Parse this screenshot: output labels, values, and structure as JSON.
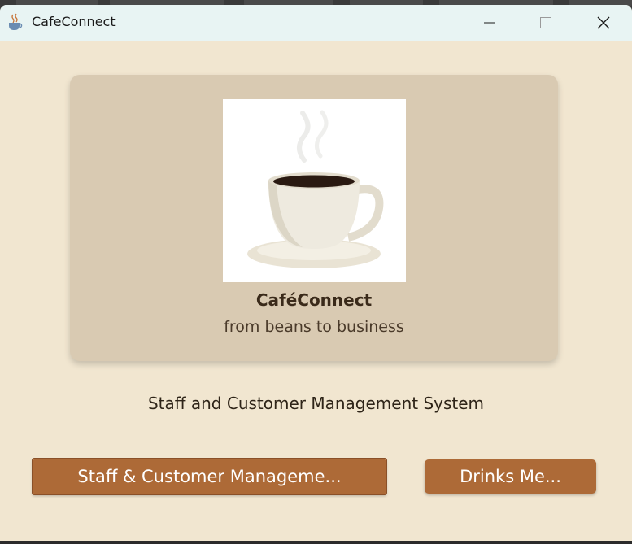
{
  "window": {
    "title": "CafeConnect",
    "app_icon": "coffee-cup-icon",
    "controls": {
      "minimize_icon": "minimize-icon",
      "maximize_icon": "maximize-icon",
      "close_icon": "close-icon"
    }
  },
  "card": {
    "logo_icon": "coffee-cup-logo",
    "brand_name": "CaféConnect",
    "tagline": "from beans to business"
  },
  "system_title": "Staff and Customer Management System",
  "buttons": {
    "staff_customer_label": "Staff & Customer Manageme...",
    "drinks_label": "Drinks Me..."
  },
  "colors": {
    "background": "#f1e6d0",
    "card": "#d9cab2",
    "button": "#ad6a37",
    "titlebar": "#e8f4f3"
  }
}
